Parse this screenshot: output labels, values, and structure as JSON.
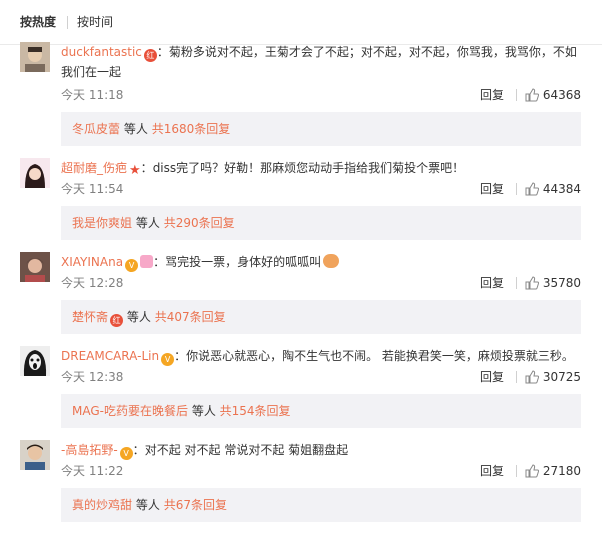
{
  "sort": {
    "active": "按热度",
    "inactive": "按时间"
  },
  "comments": [
    {
      "username": "duckfantastic",
      "colon": "：",
      "text": "菊粉多说对不起，王菊才会了不起；对不起，对不起，你骂我，我骂你，不如",
      "text_cont": "我们在一起",
      "time": "今天 11:18",
      "reply": "回复",
      "likes": "64368",
      "sub_user": "冬瓜皮蕾",
      "sub_mid": "等人",
      "sub_count": "共1680条回复"
    },
    {
      "username": "超耐磨_伤疤",
      "colon": "：",
      "text": "diss完了吗？好勒！那麻烦您动动手指给我们菊投个票吧！",
      "time": "今天 11:54",
      "reply": "回复",
      "likes": "44384",
      "sub_user": "我是你爽姐",
      "sub_mid": "等人",
      "sub_count": "共290条回复"
    },
    {
      "username": "XIAYINAna",
      "colon": "：",
      "text": "骂完投一票，身体好的呱呱叫",
      "time": "今天 12:28",
      "reply": "回复",
      "likes": "35780",
      "sub_user": "楚怀斋",
      "sub_mid": "等人",
      "sub_count": "共407条回复"
    },
    {
      "username": "DREAMCARA-Lin",
      "colon": "：",
      "text": "你说恶心就恶心，陶不生气也不闹。 若能换君笑一笑，麻烦投票就三秒。",
      "time": "今天 12:38",
      "reply": "回复",
      "likes": "30725",
      "sub_user": "MAG-吃药要在晚餐后",
      "sub_mid": "等人",
      "sub_count": "共154条回复"
    },
    {
      "username": "-高島拓野-",
      "colon": "：",
      "text": "对不起 对不起 常说对不起 菊姐翻盘起",
      "time": "今天 11:22",
      "reply": "回复",
      "likes": "27180",
      "sub_user": "真的炒鸡甜",
      "sub_mid": "等人",
      "sub_count": "共67条回复"
    }
  ],
  "badges": {
    "red_label": "红",
    "vip_label": "V"
  },
  "colors": {
    "username": "#eb7350",
    "subbox_bg": "#f2f2f5",
    "time": "#808080"
  },
  "icons": {
    "like": "thumbs-up-icon",
    "badge": "member-badge-icon"
  }
}
